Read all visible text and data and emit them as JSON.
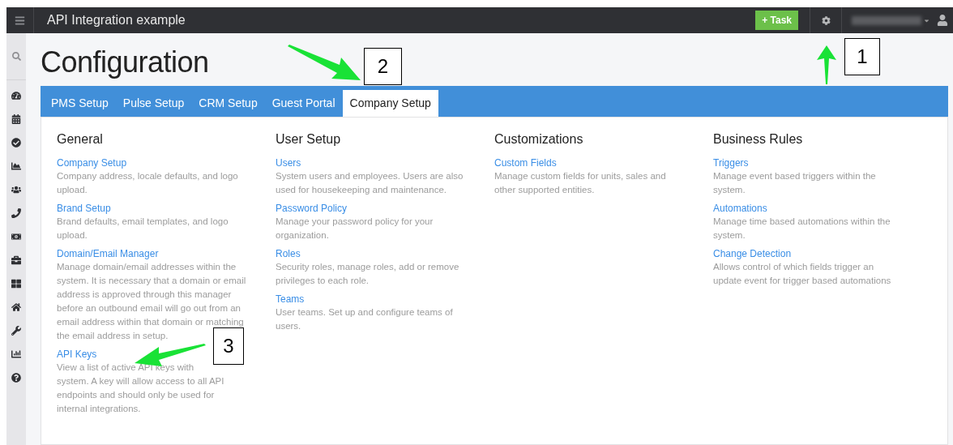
{
  "topbar": {
    "title": "API Integration example",
    "task_button": "+ Task"
  },
  "page_title": "Configuration",
  "tabs": [
    {
      "label": "PMS Setup",
      "selected": false
    },
    {
      "label": "Pulse Setup",
      "selected": false
    },
    {
      "label": "CRM Setup",
      "selected": false
    },
    {
      "label": "Guest Portal",
      "selected": false
    },
    {
      "label": "Company Setup",
      "selected": true
    }
  ],
  "sections": [
    {
      "heading": "General",
      "items": [
        {
          "link": "Company Setup",
          "description": [
            "Company address, locale defaults, and logo",
            "upload."
          ]
        },
        {
          "link": "Brand Setup",
          "description": [
            "Brand defaults, email templates, and logo",
            "upload."
          ]
        },
        {
          "link": "Domain/Email Manager",
          "description": [
            "Manage domain/email addresses within the",
            "system. It is necessary that a domain or email",
            "address is approved through this manager",
            "before an outbound email will go out from an",
            "email address within that domain or matching",
            "the email address in setup."
          ]
        },
        {
          "link": "API Keys",
          "description": [
            "View a list of active API keys with",
            "system. A key will allow access to all API",
            "endpoints and should only be used for",
            "internal integrations."
          ]
        }
      ]
    },
    {
      "heading": "User Setup",
      "items": [
        {
          "link": "Users",
          "description": [
            "System users and employees. Users are also",
            "used for housekeeping and maintenance."
          ]
        },
        {
          "link": "Password Policy",
          "description": [
            "Manage your password policy for your",
            "organization."
          ]
        },
        {
          "link": "Roles",
          "description": [
            "Security roles, manage roles, add or remove",
            "privileges to each role."
          ]
        },
        {
          "link": "Teams",
          "description": [
            "User teams. Set up and configure teams of",
            "users."
          ]
        }
      ]
    },
    {
      "heading": "Customizations",
      "items": [
        {
          "link": "Custom Fields",
          "description": [
            "Manage custom fields for units, sales and",
            "other supported entities."
          ]
        }
      ]
    },
    {
      "heading": "Business Rules",
      "items": [
        {
          "link": "Triggers",
          "description": [
            "Manage event based triggers within the",
            "system."
          ]
        },
        {
          "link": "Automations",
          "description": [
            "Manage time based automations within the",
            "system."
          ]
        },
        {
          "link": "Change Detection",
          "description": [
            "Allows control of which fields trigger an",
            "update event for trigger based automations"
          ]
        }
      ]
    }
  ],
  "callouts": [
    "1",
    "2",
    "3"
  ]
}
